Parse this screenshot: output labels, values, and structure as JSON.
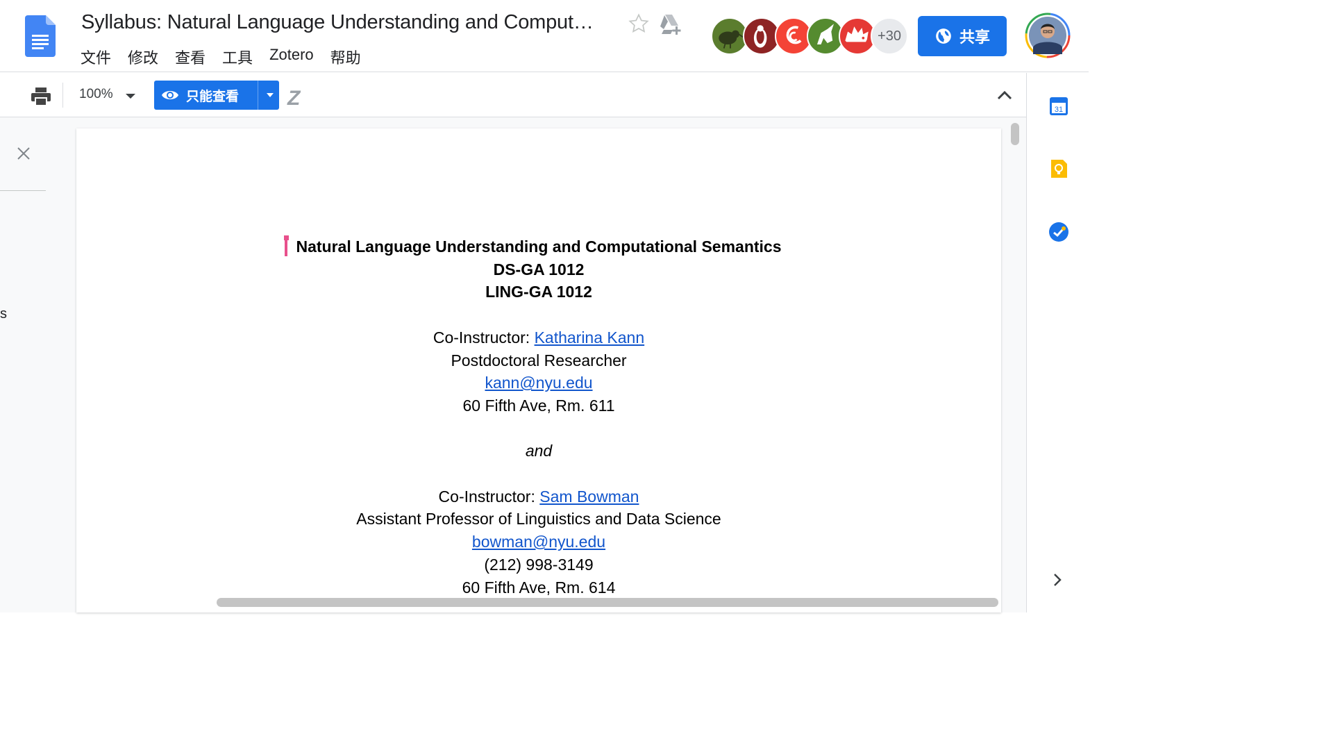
{
  "document": {
    "title": "Syllabus: Natural Language Understanding and Comput…"
  },
  "menu": [
    "文件",
    "修改",
    "查看",
    "工具",
    "Zotero",
    "帮助"
  ],
  "collaborators": {
    "avatars": [
      "kiwi-avatar",
      "penguin-avatar",
      "dragon-avatar",
      "unicorn-avatar",
      "hedgehog-avatar"
    ],
    "more_count": "+30"
  },
  "share_button": {
    "label": "共享"
  },
  "toolbar": {
    "zoom": "100%",
    "mode_label": "只能查看",
    "zotero_label": "Z"
  },
  "outline": {
    "partial_text": "s"
  },
  "side_panel": {
    "calendar_day": "31",
    "icons": [
      "calendar-icon",
      "keep-icon",
      "tasks-icon"
    ]
  },
  "body": {
    "course_title": "Natural Language Understanding and Computational Semantics",
    "course_code_1": "DS-GA 1012",
    "course_code_2": "LING-GA 1012",
    "instructor1": {
      "role": "Co-Instructor: ",
      "name": "Katharina Kann",
      "position": "Postdoctoral Researcher",
      "email": "kann@nyu.edu",
      "office": "60 Fifth Ave, Rm. 611"
    },
    "and": "and",
    "instructor2": {
      "role": "Co-Instructor: ",
      "name": "Sam Bowman",
      "position": "Assistant Professor of Linguistics and Data Science",
      "email": "bowman@nyu.edu",
      "phone": "(212) 998-3149",
      "office": "60 Fifth Ave, Rm. 614"
    }
  },
  "colors": {
    "accent": "#1a73e8",
    "link": "#1155cc",
    "cursor": "#e8508c"
  }
}
